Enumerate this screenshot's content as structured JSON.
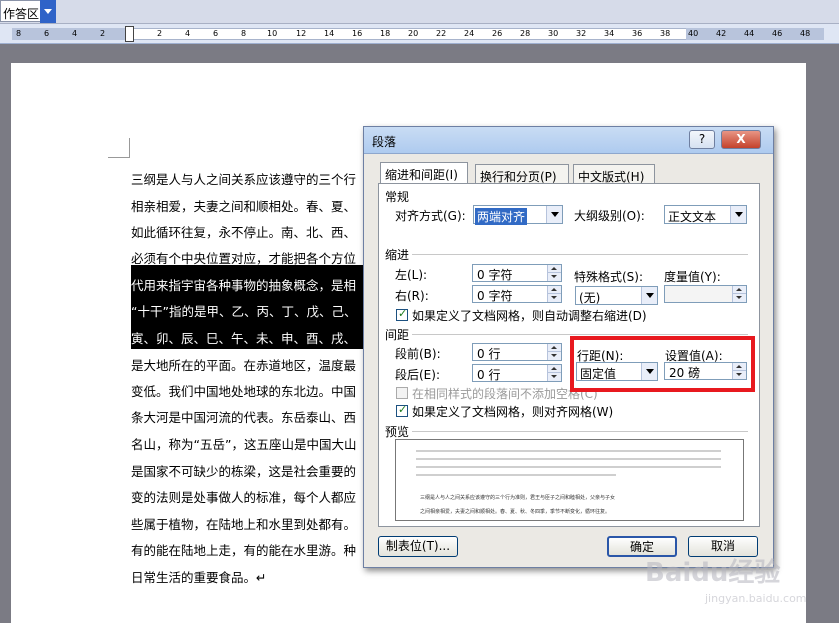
{
  "toolbar": {
    "tab_label": "作答区"
  },
  "ruler": {
    "ticks": [
      "8",
      "6",
      "4",
      "2",
      "2",
      "4",
      "6",
      "8",
      "10",
      "12",
      "14",
      "16",
      "18",
      "20",
      "22",
      "24",
      "26",
      "28",
      "30",
      "32",
      "34",
      "36",
      "38",
      "40",
      "42",
      "44",
      "46",
      "48"
    ]
  },
  "document": {
    "lines": [
      "三纲是人与人之间关系应该遵守的三个行",
      "相亲相爱，夫妻之间和顺相处。春、夏、",
      "如此循环往复，永不停止。南、北、西、",
      "必须有个中央位置对应，才能把各个方位",
      "代用来指宇宙各种事物的抽象概念，是相",
      "“十干”指的是甲、乙、丙、丁、戊、己、",
      "寅、卯、辰、巳、午、未、申、酉、戌、",
      "是大地所在的平面。在赤道地区，温度最",
      "变低。我们中国地处地球的东北边。中国",
      "条大河是中国河流的代表。东岳泰山、西",
      "名山，称为“五岳”，这五座山是中国大山",
      "是国家不可缺少的栋梁，这是社会重要的",
      "变的法则是处事做人的标准，每个人都应",
      "些属于植物，在陆地上和水里到处都有。",
      "有的能在陆地上走，有的能在水里游。种",
      "日常生活的重要食品。↵"
    ]
  },
  "dialog": {
    "title": "段落",
    "help_label": "?",
    "close_label": "X",
    "tabs": [
      "缩进和间距(I)",
      "换行和分页(P)",
      "中文版式(H)"
    ],
    "general": {
      "section": "常规",
      "align_label": "对齐方式(G):",
      "align_value": "两端对齐",
      "outline_label": "大纲级别(O):",
      "outline_value": "正文文本"
    },
    "indent": {
      "section": "缩进",
      "left_label": "左(L):",
      "left_value": "0 字符",
      "right_label": "右(R):",
      "right_value": "0 字符",
      "special_label": "特殊格式(S):",
      "special_value": "(无)",
      "measure_label": "度量值(Y):",
      "measure_value": "",
      "auto_adjust_label": "如果定义了文档网格，则自动调整右缩进(D)"
    },
    "spacing": {
      "section": "间距",
      "before_label": "段前(B):",
      "before_value": "0 行",
      "after_label": "段后(E):",
      "after_value": "0 行",
      "line_label": "行距(N):",
      "line_value": "固定值",
      "set_label": "设置值(A):",
      "set_value": "20 磅",
      "no_space_label": "在相同样式的段落间不添加空格(C)",
      "snap_grid_label": "如果定义了文档网格，则对齐网格(W)"
    },
    "preview": {
      "section": "预览",
      "sample_line_1": "三纲是人与人之间关系应该遵守的三个行为准则，君王与臣子之间和睦相处，父亲与子女",
      "sample_line_2": "之间相亲相爱，夫妻之间和顺相处。春、夏、秋、冬四季，季节不断变化，循环往复。"
    },
    "buttons": {
      "tabs_label": "制表位(T)...",
      "ok_label": "确定",
      "cancel_label": "取消"
    }
  },
  "watermark": {
    "brand": "Baidu经验",
    "url": "jingyan.baidu.com"
  }
}
